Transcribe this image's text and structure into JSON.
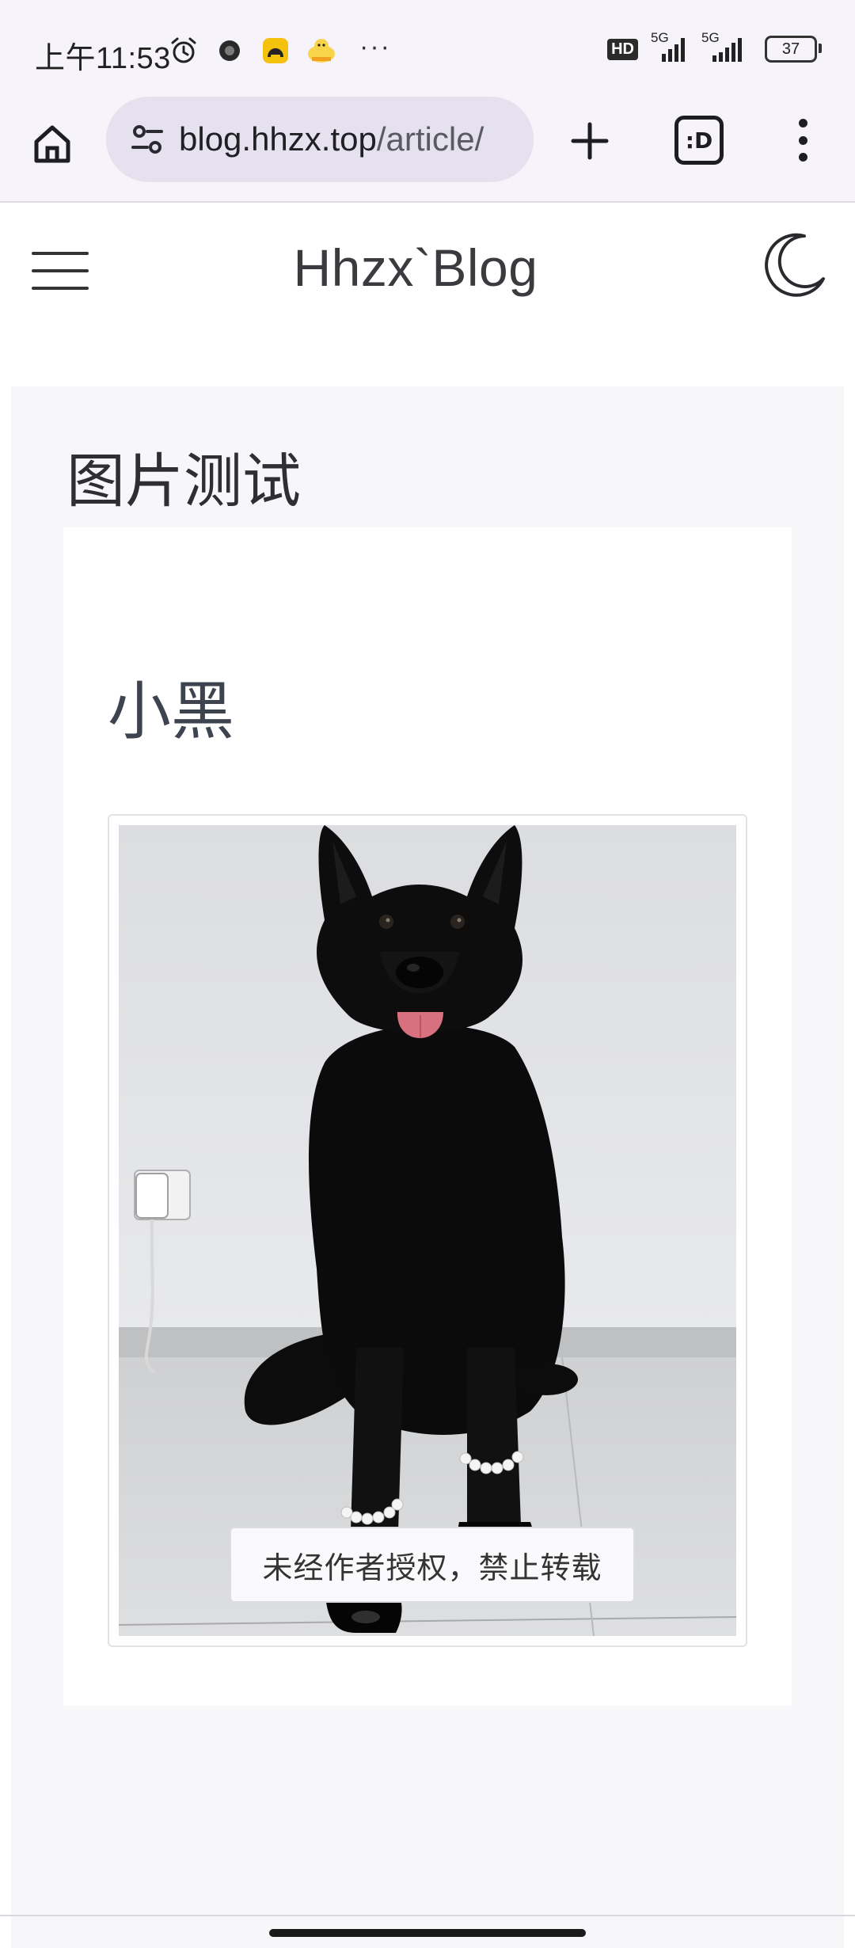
{
  "status_bar": {
    "time": "上午11:53",
    "network_badge": "HD",
    "signal_1_label": "5G",
    "signal_2_label": "5G",
    "battery": "37",
    "overflow": "···"
  },
  "browser": {
    "url_host": "blog.hhzx.top",
    "url_path": "/article/",
    "tabs_label": ":D"
  },
  "site": {
    "title": "Hhzx`Blog"
  },
  "article": {
    "title": "图片测试",
    "heading": "小黑",
    "copyright_notice": "未经作者授权，禁止转载"
  },
  "colors": {
    "status_bar_bg": "#f6f3fb",
    "url_pill_bg": "#e5e1ee",
    "page_bg": "#ffffff",
    "article_bg": "#f7f7fa",
    "text_primary": "#333333",
    "heading": "#3d4450"
  }
}
